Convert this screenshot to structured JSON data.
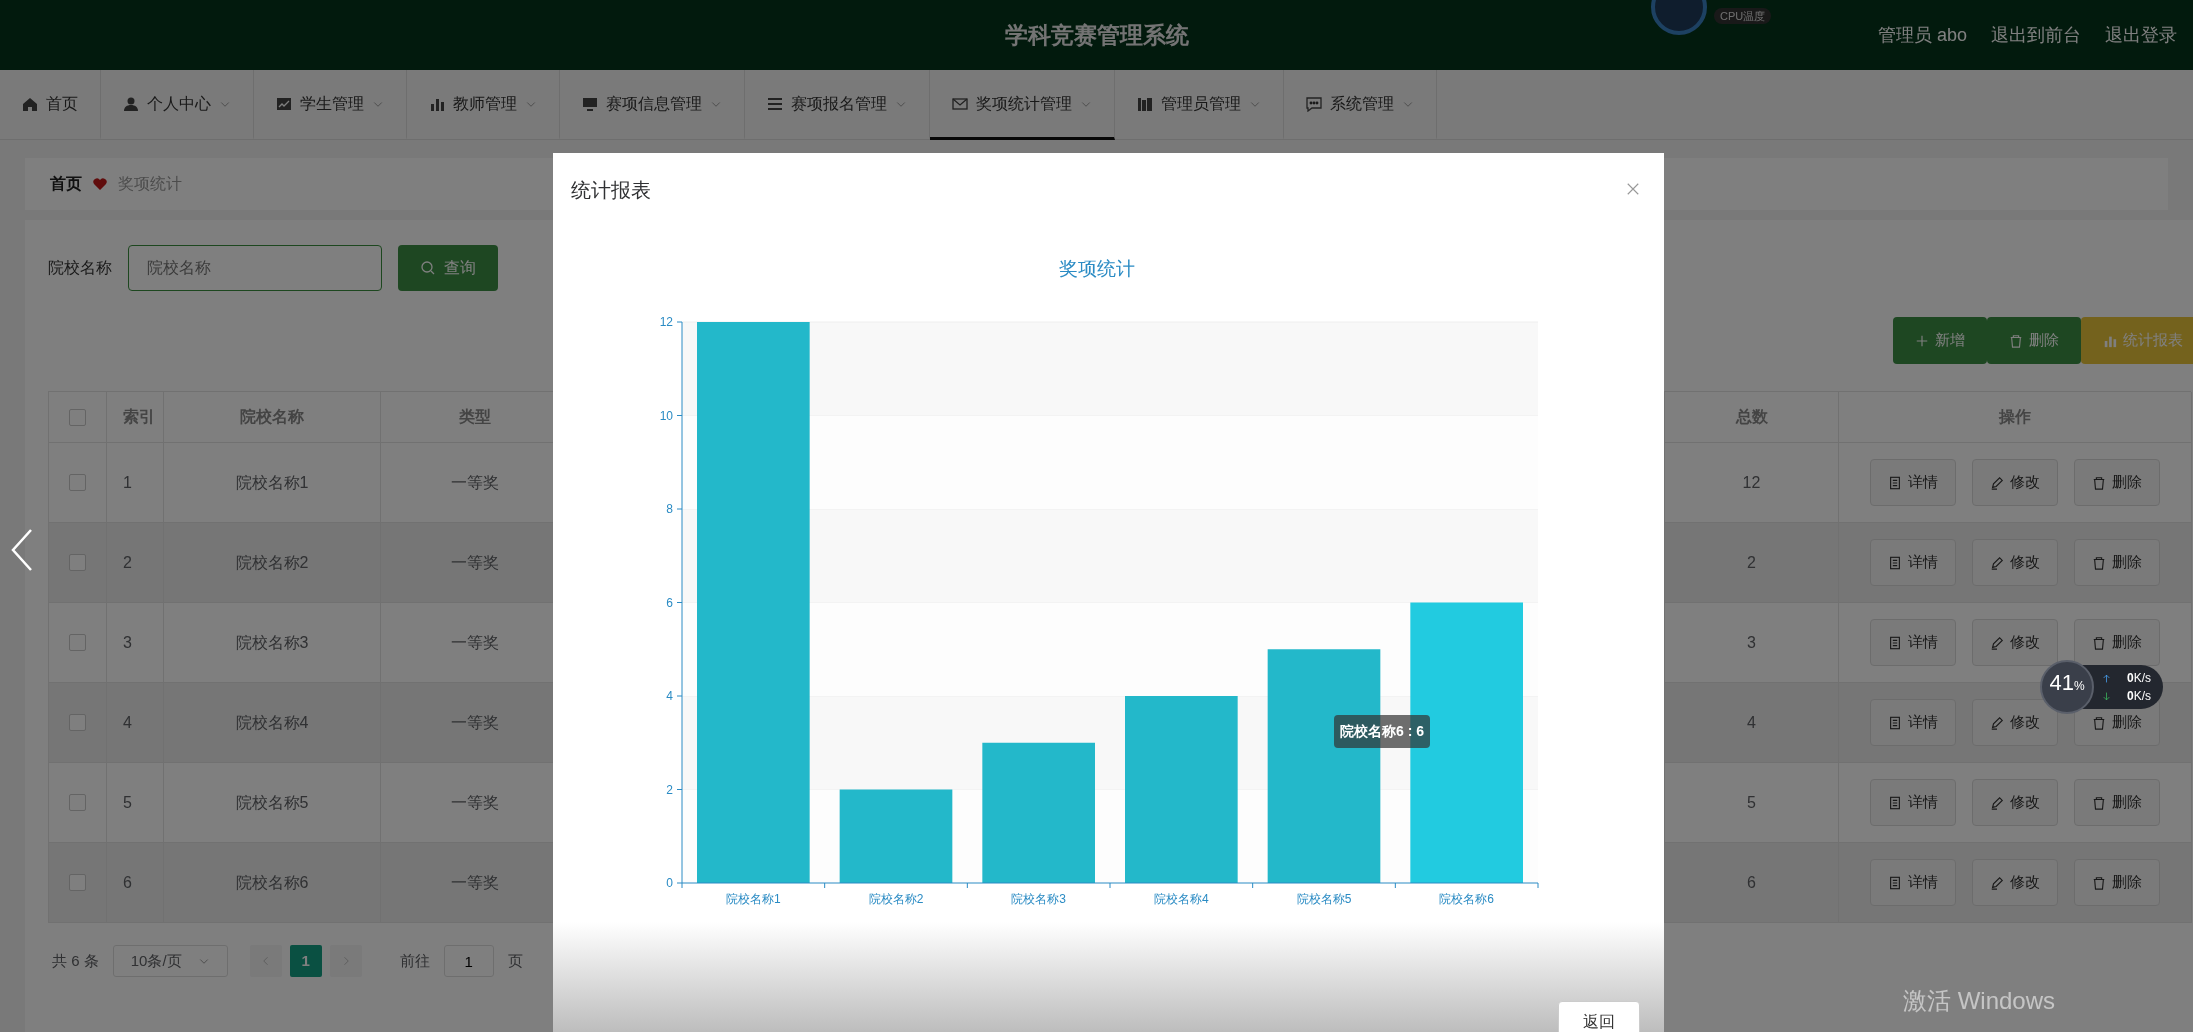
{
  "header": {
    "title": "学科竞赛管理系统",
    "user": "管理员 abo",
    "links": [
      "退出到前台",
      "退出登录"
    ]
  },
  "cpu_gauge": {
    "label": "CPU温度"
  },
  "nav": [
    {
      "label": "首页",
      "selected": false,
      "dropdown": false
    },
    {
      "label": "个人中心",
      "selected": false,
      "dropdown": true
    },
    {
      "label": "学生管理",
      "selected": false,
      "dropdown": true
    },
    {
      "label": "教师管理",
      "selected": false,
      "dropdown": true
    },
    {
      "label": "赛项信息管理",
      "selected": false,
      "dropdown": true
    },
    {
      "label": "赛项报名管理",
      "selected": false,
      "dropdown": true
    },
    {
      "label": "奖项统计管理",
      "selected": true,
      "dropdown": true
    },
    {
      "label": "管理员管理",
      "selected": false,
      "dropdown": true
    },
    {
      "label": "系统管理",
      "selected": false,
      "dropdown": true
    }
  ],
  "breadcrumb": [
    "首页",
    "奖项统计"
  ],
  "search": {
    "label": "院校名称",
    "placeholder": "院校名称",
    "button": "查询"
  },
  "actions": [
    {
      "label": "新增",
      "kind": "add"
    },
    {
      "label": "删除",
      "kind": "delete"
    },
    {
      "label": "统计报表",
      "kind": "report"
    }
  ],
  "table": {
    "all_checked": false,
    "columns": [
      "索引",
      "院校名称",
      "类型",
      "总数",
      "操作"
    ],
    "rows": [
      {
        "index": "1",
        "school": "院校名称1",
        "type": "一等奖",
        "total": "12",
        "checked": false,
        "actions": [
          "详情",
          "修改",
          "删除"
        ]
      },
      {
        "index": "2",
        "school": "院校名称2",
        "type": "一等奖",
        "total": "2",
        "checked": false,
        "actions": [
          "详情",
          "修改",
          "删除"
        ]
      },
      {
        "index": "3",
        "school": "院校名称3",
        "type": "一等奖",
        "total": "3",
        "checked": false,
        "actions": [
          "详情",
          "修改",
          "删除"
        ]
      },
      {
        "index": "4",
        "school": "院校名称4",
        "type": "一等奖",
        "total": "4",
        "checked": false,
        "actions": [
          "详情",
          "修改",
          "删除"
        ]
      },
      {
        "index": "5",
        "school": "院校名称5",
        "type": "一等奖",
        "total": "5",
        "checked": false,
        "actions": [
          "详情",
          "修改",
          "删除"
        ]
      },
      {
        "index": "6",
        "school": "院校名称6",
        "type": "一等奖",
        "total": "6",
        "checked": false,
        "actions": [
          "详情",
          "修改",
          "删除"
        ]
      }
    ]
  },
  "pagination": {
    "total": "共 6 条",
    "page_size": "10条/页",
    "pages": [
      {
        "label": "1",
        "selected": true
      }
    ],
    "goto_label": "前往",
    "goto_value": "1",
    "page_unit": "页"
  },
  "modal": {
    "title": "统计报表",
    "footer_button": "返回",
    "tooltip": "院校名称6 : 6",
    "bar_hover": [
      false,
      false,
      false,
      false,
      false,
      true
    ],
    "chart_data": {
      "type": "bar",
      "title": "奖项统计",
      "categories": [
        "院校名称1",
        "院校名称2",
        "院校名称3",
        "院校名称4",
        "院校名称5",
        "院校名称6"
      ],
      "values": [
        12,
        2,
        3,
        4,
        5,
        6
      ],
      "grid": true,
      "ylim": [
        0,
        12
      ],
      "yticks": [
        0,
        2,
        4,
        6,
        8,
        10,
        12
      ]
    }
  },
  "net_widget": {
    "percent": "41",
    "percent_unit": "%",
    "upload": "0",
    "upload_unit": "K/s",
    "download": "0",
    "download_unit": "K/s"
  },
  "os_notice": "激活 Windows"
}
